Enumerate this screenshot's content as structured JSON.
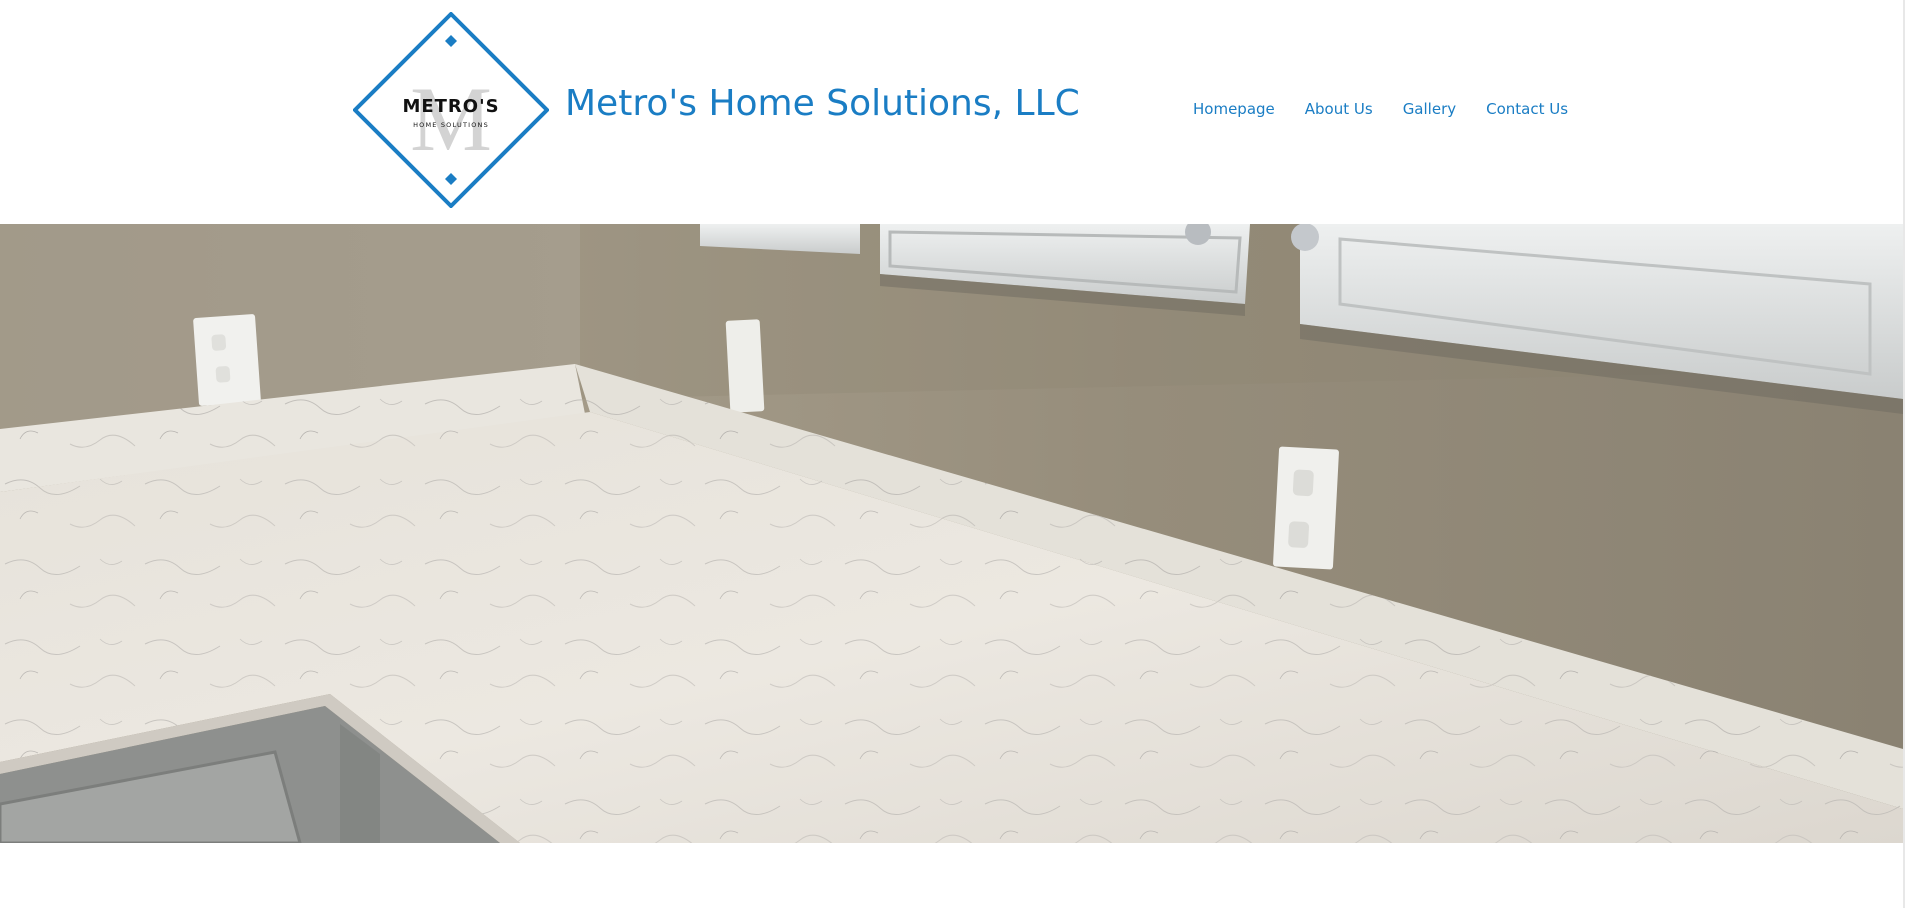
{
  "brand": {
    "logo_word": "METRO'S",
    "logo_subtitle": "HOME SOLUTIONS",
    "logo_monogram": "M",
    "title": "Metro's Home Solutions, LLC",
    "brand_color": "#1a7dc4"
  },
  "nav": {
    "items": [
      {
        "label": "Homepage"
      },
      {
        "label": "About Us"
      },
      {
        "label": "Gallery"
      },
      {
        "label": "Contact Us"
      }
    ]
  },
  "hero": {
    "subject": "kitchen-countertop-photo"
  }
}
